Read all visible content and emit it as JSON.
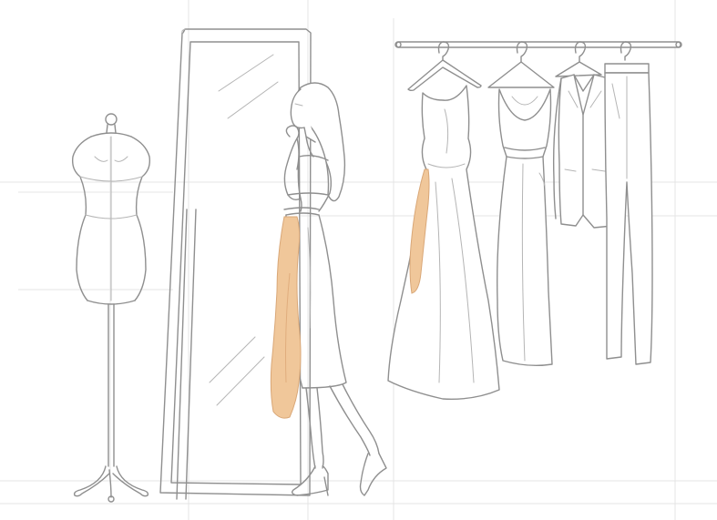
{
  "image": {
    "kind": "pencil sketch illustration",
    "background_color": "#ffffff",
    "line_color": "#8f8f8f",
    "guide_line_color": "#e4e4e4",
    "accent_color": "#f0c79a"
  },
  "objects": {
    "mannequin": "dress-form",
    "mirror": "standing-floor-mirror",
    "woman": "woman-in-skirt",
    "drape": "orange-fabric-drape",
    "rack": "clothing-rail",
    "garments": [
      "gown",
      "slip-dress",
      "blazer",
      "trousers"
    ],
    "hanger_count": 4
  }
}
